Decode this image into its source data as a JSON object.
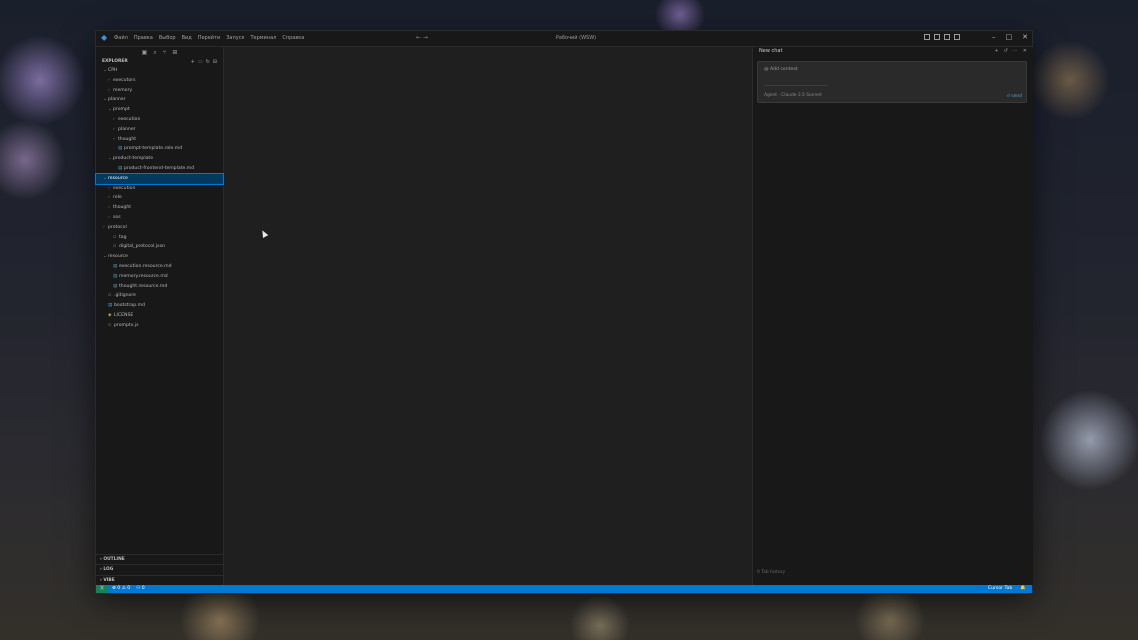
{
  "window": {
    "title": "Рабочий (WSW)",
    "menu": [
      "Файл",
      "Правка",
      "Выбор",
      "Вид",
      "Перейти",
      "Запуск",
      "Терминал",
      "Справка"
    ]
  },
  "sidebar": {
    "header": "EXPLORER",
    "tree": [
      {
        "label": "CPH",
        "indent": 1,
        "kind": "folder",
        "open": true
      },
      {
        "label": "executors",
        "indent": 2,
        "kind": "folder",
        "open": false
      },
      {
        "label": "memory",
        "indent": 2,
        "kind": "folder",
        "open": false
      },
      {
        "label": "planner",
        "indent": 1,
        "kind": "folder",
        "open": true
      },
      {
        "label": "prompt",
        "indent": 2,
        "kind": "folder",
        "open": true
      },
      {
        "label": "execution",
        "indent": 3,
        "kind": "folder",
        "open": false
      },
      {
        "label": "planner",
        "indent": 3,
        "kind": "folder",
        "open": false
      },
      {
        "label": "thought",
        "indent": 3,
        "kind": "folder",
        "open": false
      },
      {
        "label": "prompt-template.role.md",
        "indent": 3,
        "kind": "md",
        "open": false
      },
      {
        "label": "product-template",
        "indent": 2,
        "kind": "folder",
        "open": true
      },
      {
        "label": "product-frontend-template.md",
        "indent": 3,
        "kind": "md",
        "open": false
      },
      {
        "label": "resource",
        "indent": 1,
        "kind": "folder",
        "open": true,
        "selected": true
      },
      {
        "label": "execution",
        "indent": 2,
        "kind": "folder",
        "open": false
      },
      {
        "label": "role",
        "indent": 2,
        "kind": "folder",
        "open": false
      },
      {
        "label": "thought",
        "indent": 2,
        "kind": "folder",
        "open": false
      },
      {
        "label": "sos",
        "indent": 2,
        "kind": "folder",
        "open": false
      },
      {
        "label": "protocol",
        "indent": 1,
        "kind": "folder",
        "open": false
      },
      {
        "label": "tag",
        "indent": 2,
        "kind": "file",
        "open": false
      },
      {
        "label": "digital_protocol.json",
        "indent": 2,
        "kind": "file",
        "open": false
      },
      {
        "label": "resource",
        "indent": 1,
        "kind": "folder",
        "open": true
      },
      {
        "label": "execution.resource.md",
        "indent": 2,
        "kind": "md",
        "open": false
      },
      {
        "label": "memory.resource.md",
        "indent": 2,
        "kind": "md",
        "open": false
      },
      {
        "label": "thought.resource.md",
        "indent": 2,
        "kind": "md",
        "open": false
      },
      {
        "label": ".gitignore",
        "indent": 1,
        "kind": "file",
        "open": false
      },
      {
        "label": "bootstrap.md",
        "indent": 1,
        "kind": "md",
        "open": false
      },
      {
        "label": "LICENSE",
        "indent": 1,
        "kind": "js",
        "open": false
      },
      {
        "label": "promptx.js",
        "indent": 1,
        "kind": "file",
        "open": false
      }
    ],
    "sections": [
      "OUTLINE",
      "LOG",
      "VIBE"
    ]
  },
  "chat": {
    "title": "New chat",
    "context_label": "@ Add context",
    "mode_label": "Agent · Claude 3.5 Sonnet",
    "send_label": "⏎ send",
    "footer": "0 Tab history"
  },
  "status": {
    "left_items": [
      "⊗ 0 ⚠ 0",
      "⚇ 0"
    ],
    "right_items": [
      "Cursor Tab",
      "🔔"
    ]
  }
}
